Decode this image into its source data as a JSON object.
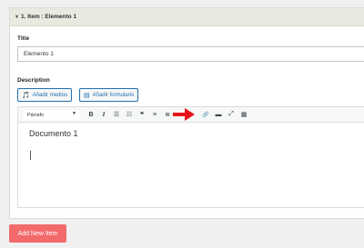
{
  "item": {
    "header": "1. Item : Elemento 1",
    "title_label": "Title",
    "title_value": "Elemento 1",
    "description_label": "Description"
  },
  "media": {
    "add_media": "Añadir medios",
    "add_form": "Añadir formulario"
  },
  "toolbar": {
    "format_value": "Párrafo",
    "buttons": [
      {
        "icon": "bold-icon",
        "glyph": "B"
      },
      {
        "icon": "italic-icon",
        "glyph": "I"
      },
      {
        "icon": "bullet-list-icon",
        "glyph": "☰"
      },
      {
        "icon": "numbered-list-icon",
        "glyph": "☷"
      },
      {
        "icon": "blockquote-icon",
        "glyph": "❝"
      },
      {
        "icon": "align-left-icon",
        "glyph": "≡"
      },
      {
        "icon": "align-center-icon",
        "glyph": "≣"
      },
      {
        "icon": "link-icon",
        "glyph": "🔗"
      },
      {
        "icon": "read-more-icon",
        "glyph": "▬"
      },
      {
        "icon": "fullscreen-icon",
        "glyph": "⤢"
      },
      {
        "icon": "toolbar-toggle-icon",
        "glyph": "▦"
      }
    ]
  },
  "editor": {
    "content": "Documento 1"
  },
  "actions": {
    "add_new_item": "Add New Item"
  },
  "colors": {
    "accent": "#2271b1",
    "add_button": "#f26a6a",
    "annotation_arrow": "#e8161b"
  }
}
